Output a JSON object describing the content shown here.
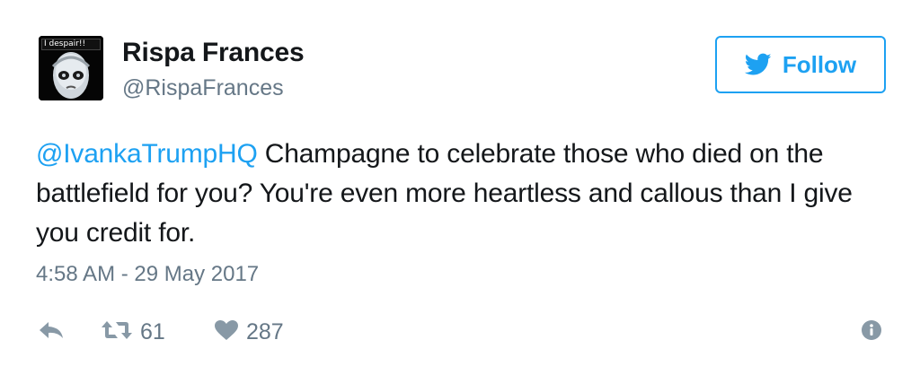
{
  "user": {
    "avatar_caption": "I despair!!",
    "display_name": "Rispa Frances",
    "handle": "@RispaFrances"
  },
  "follow_button": {
    "label": "Follow",
    "icon": "twitter-bird-icon"
  },
  "tweet": {
    "mention": "@IvankaTrumpHQ",
    "text": " Champagne to celebrate those who died on the battlefield for you? You're even more heartless and callous than I give you credit for.",
    "timestamp": "4:58 AM - 29 May 2017"
  },
  "actions": {
    "reply_icon": "reply-icon",
    "retweet_icon": "retweet-icon",
    "retweet_count": "61",
    "like_icon": "heart-icon",
    "like_count": "287",
    "more_icon": "info-icon"
  },
  "colors": {
    "accent": "#1da1f2",
    "text": "#14171a",
    "secondary": "#657786",
    "icon": "#8899a6"
  }
}
